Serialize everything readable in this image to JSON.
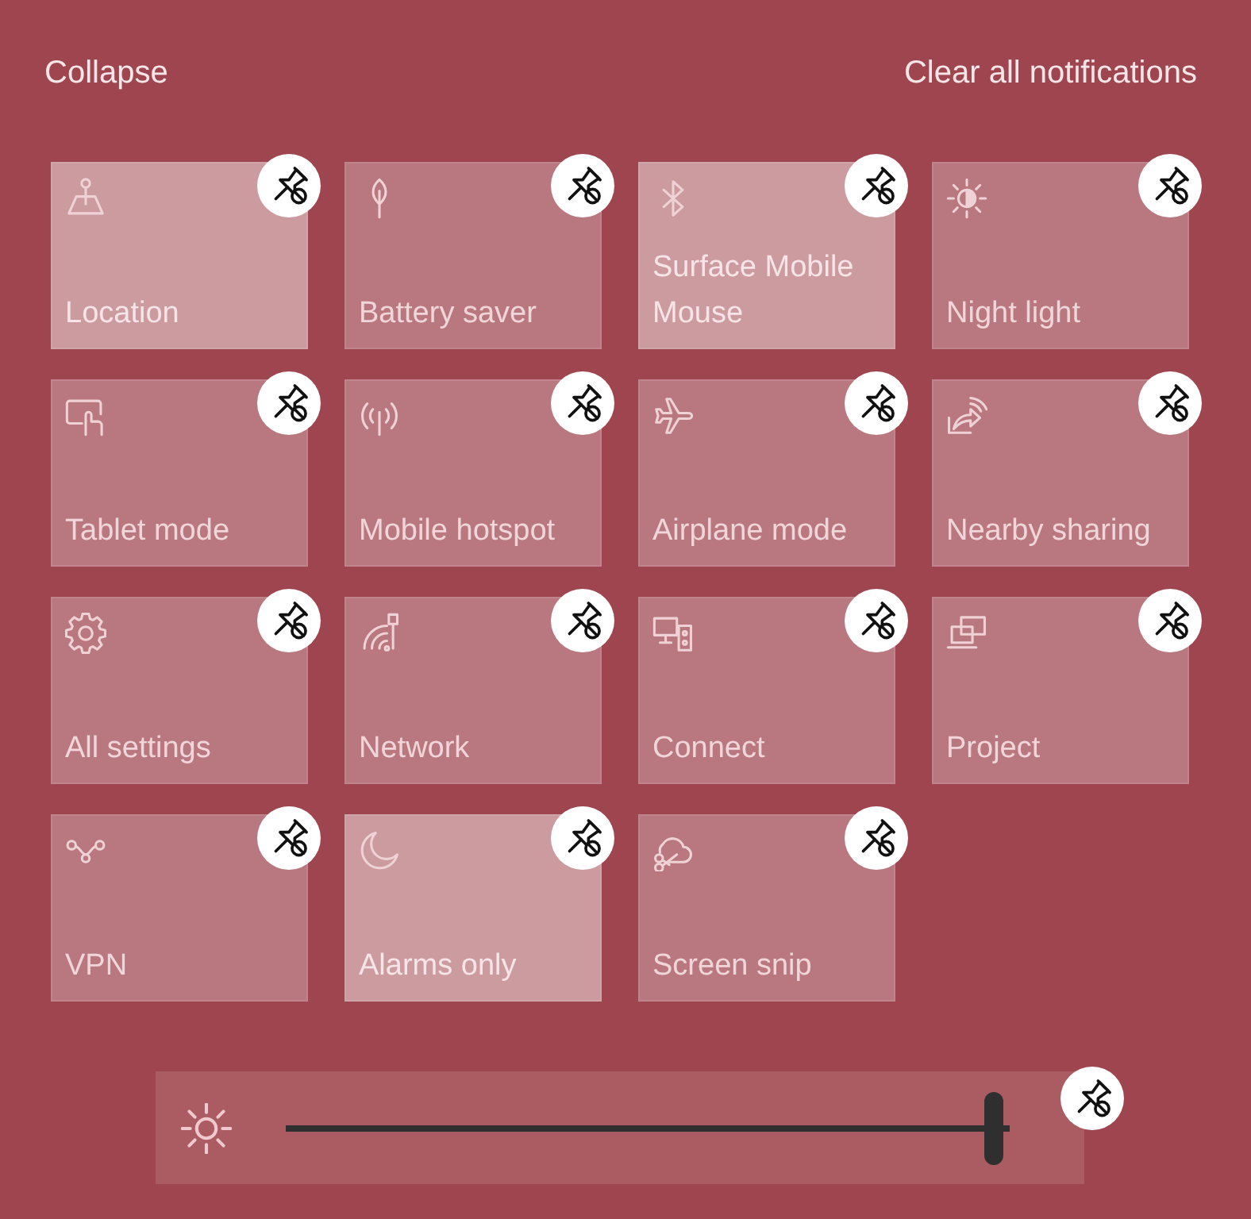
{
  "header": {
    "collapse": "Collapse",
    "clear_all": "Clear all notifications"
  },
  "tiles": [
    {
      "kind": "location",
      "label": "Location",
      "on": true
    },
    {
      "kind": "battery",
      "label": "Battery saver",
      "on": false
    },
    {
      "kind": "bluetooth",
      "label": "Surface Mobile Mouse",
      "on": true
    },
    {
      "kind": "nightlight",
      "label": "Night light",
      "on": false
    },
    {
      "kind": "tablet",
      "label": "Tablet mode",
      "on": false
    },
    {
      "kind": "hotspot",
      "label": "Mobile hotspot",
      "on": false
    },
    {
      "kind": "airplane",
      "label": "Airplane mode",
      "on": false
    },
    {
      "kind": "nearby",
      "label": "Nearby sharing",
      "on": false
    },
    {
      "kind": "settings",
      "label": "All settings",
      "on": false
    },
    {
      "kind": "network",
      "label": "Network",
      "on": false
    },
    {
      "kind": "connect",
      "label": "Connect",
      "on": false
    },
    {
      "kind": "project",
      "label": "Project",
      "on": false
    },
    {
      "kind": "vpn",
      "label": "VPN",
      "on": false
    },
    {
      "kind": "alarms",
      "label": "Alarms only",
      "on": true
    },
    {
      "kind": "screensnip",
      "label": "Screen snip",
      "on": false
    }
  ],
  "brightness": {
    "level": 0.99
  }
}
